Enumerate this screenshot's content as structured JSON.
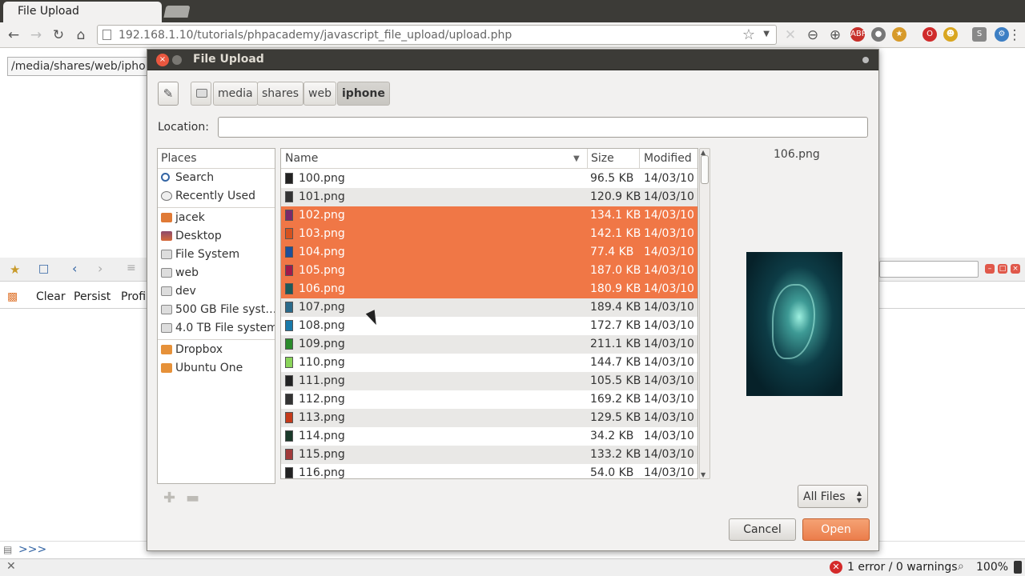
{
  "browser": {
    "tab_title": "File Upload",
    "url": "192.168.1.10/tutorials/phpacademy/javascript_file_upload/upload.php"
  },
  "page": {
    "path_input_value": "/media/shares/web/iphon",
    "firebug": {
      "tabs": [
        "Clear",
        "Persist",
        "Profi"
      ],
      "console_prompt": ">>>",
      "status_errors": "1 error / 0 warnings",
      "zoom": "100%"
    }
  },
  "dialog": {
    "title": "File Upload",
    "breadcrumbs": [
      "media",
      "shares",
      "web",
      "iphone"
    ],
    "active_crumb": "iphone",
    "location_label": "Location:",
    "location_value": "",
    "places_header": "Places",
    "places": [
      {
        "label": "Search",
        "icon": "search-icon"
      },
      {
        "label": "Recently Used",
        "icon": "recent-icon"
      },
      {
        "label": "jacek",
        "icon": "home-folder-icon"
      },
      {
        "label": "Desktop",
        "icon": "desktop-icon"
      },
      {
        "label": "File System",
        "icon": "drive-icon"
      },
      {
        "label": "web",
        "icon": "drive-icon"
      },
      {
        "label": "dev",
        "icon": "drive-icon"
      },
      {
        "label": "500 GB File syst…",
        "icon": "drive-icon"
      },
      {
        "label": "4.0 TB File system",
        "icon": "drive-icon"
      },
      {
        "label": "Dropbox",
        "icon": "folder-icon"
      },
      {
        "label": "Ubuntu One",
        "icon": "folder-icon"
      }
    ],
    "columns": {
      "name": "Name",
      "size": "Size",
      "modified": "Modified"
    },
    "files": [
      {
        "name": "100.png",
        "size": "96.5 KB",
        "modified": "14/03/10",
        "selected": false
      },
      {
        "name": "101.png",
        "size": "120.9 KB",
        "modified": "14/03/10",
        "selected": false
      },
      {
        "name": "102.png",
        "size": "134.1 KB",
        "modified": "14/03/10",
        "selected": true
      },
      {
        "name": "103.png",
        "size": "142.1 KB",
        "modified": "14/03/10",
        "selected": true
      },
      {
        "name": "104.png",
        "size": "77.4 KB",
        "modified": "14/03/10",
        "selected": true
      },
      {
        "name": "105.png",
        "size": "187.0 KB",
        "modified": "14/03/10",
        "selected": true
      },
      {
        "name": "106.png",
        "size": "180.9 KB",
        "modified": "14/03/10",
        "selected": true
      },
      {
        "name": "107.png",
        "size": "189.4 KB",
        "modified": "14/03/10",
        "selected": false
      },
      {
        "name": "108.png",
        "size": "172.7 KB",
        "modified": "14/03/10",
        "selected": false
      },
      {
        "name": "109.png",
        "size": "211.1 KB",
        "modified": "14/03/10",
        "selected": false
      },
      {
        "name": "110.png",
        "size": "144.7 KB",
        "modified": "14/03/10",
        "selected": false
      },
      {
        "name": "111.png",
        "size": "105.5 KB",
        "modified": "14/03/10",
        "selected": false
      },
      {
        "name": "112.png",
        "size": "169.2 KB",
        "modified": "14/03/10",
        "selected": false
      },
      {
        "name": "113.png",
        "size": "129.5 KB",
        "modified": "14/03/10",
        "selected": false
      },
      {
        "name": "114.png",
        "size": "34.2 KB",
        "modified": "14/03/10",
        "selected": false
      },
      {
        "name": "115.png",
        "size": "133.2 KB",
        "modified": "14/03/10",
        "selected": false
      },
      {
        "name": "116.png",
        "size": "54.0 KB",
        "modified": "14/03/10",
        "selected": false
      }
    ],
    "preview_name": "106.png",
    "filter_value": "All Files",
    "cancel_label": "Cancel",
    "open_label": "Open",
    "colors": {
      "selection": "#f07746",
      "accent": "#eb7d4b"
    }
  }
}
